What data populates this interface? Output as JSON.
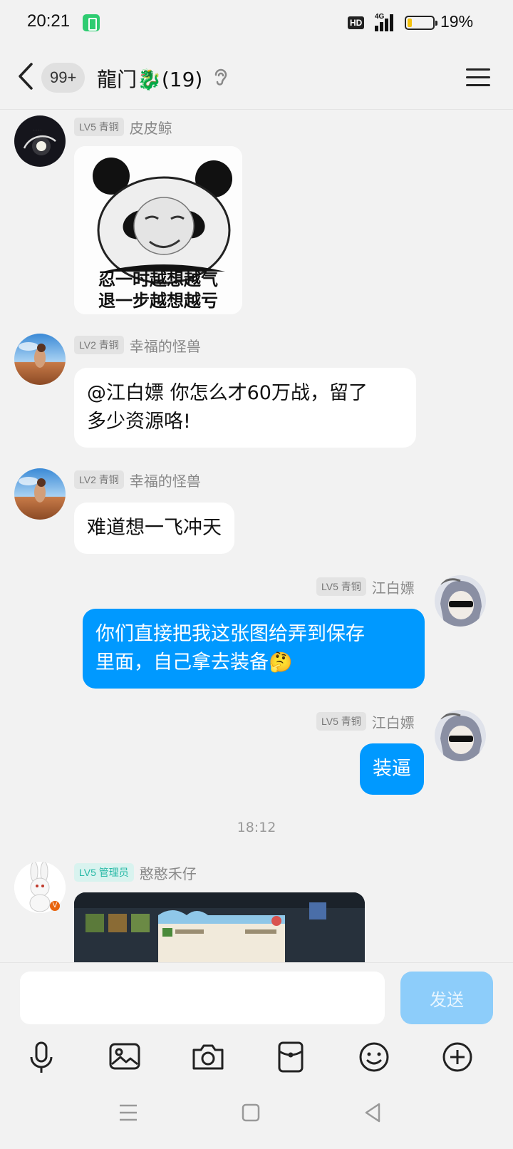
{
  "status_bar": {
    "time": "20:21",
    "hd_label": "HD",
    "network": "4G",
    "battery_percent": "19%",
    "battery_level": 0.19
  },
  "header": {
    "unread_count": "99+",
    "group_name": "龍门🐉(19)"
  },
  "messages": [
    {
      "level": "LV5 青铜",
      "nickname": "皮皮鲸",
      "sticker_caption_line1": "忍一时越想越气",
      "sticker_caption_line2": "退一步越想越亏"
    },
    {
      "level": "LV2 青铜",
      "nickname": "幸福的怪兽",
      "text_line1": "@江白嫖 你怎么才60万战，留了",
      "text_line2": "多少资源咯!"
    },
    {
      "level": "LV2 青铜",
      "nickname": "幸福的怪兽",
      "text": "难道想一飞冲天"
    },
    {
      "level": "LV5 青铜",
      "nickname": "江白嫖",
      "text_line1": "你们直接把我这张图给弄到保存",
      "text_line2": "里面，自己拿去装备🤔"
    },
    {
      "level": "LV5 青铜",
      "nickname": "江白嫖",
      "text": "装逼"
    },
    {
      "level": "LV5 管理员",
      "nickname": "憨憨禾仔"
    }
  ],
  "time_divider": "18:12",
  "input": {
    "placeholder": "",
    "send_label": "发送"
  },
  "colors": {
    "my_bubble": "#0099ff",
    "send_button_disabled": "#8dcdfa",
    "admin_tag": "#25b8a5"
  }
}
